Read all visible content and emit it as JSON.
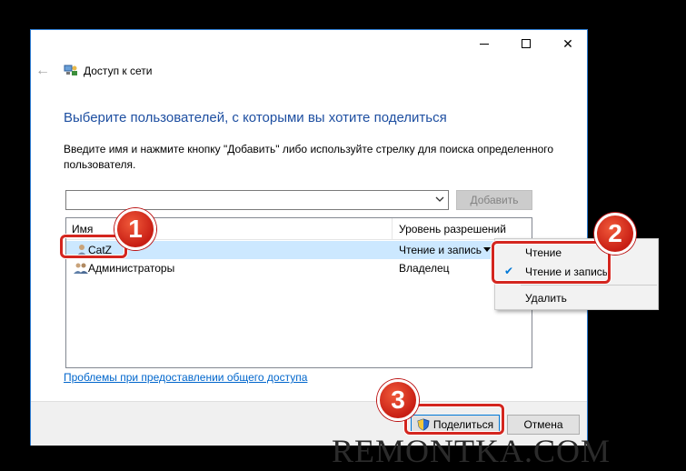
{
  "window": {
    "title": "Доступ к сети",
    "heading": "Выберите пользователей, с которыми вы хотите поделиться",
    "description": "Введите имя и нажмите кнопку \"Добавить\" либо используйте стрелку для поиска определенного пользователя.",
    "user_input_value": "",
    "add_button": "Добавить"
  },
  "table": {
    "col_name": "Имя",
    "col_permission": "Уровень разрешений",
    "rows": [
      {
        "name": "CatZ",
        "permission": "Чтение и запись"
      },
      {
        "name": "Администраторы",
        "permission": "Владелец"
      }
    ]
  },
  "context_menu": {
    "items": [
      "Чтение",
      "Чтение и запись",
      "Удалить"
    ],
    "checked": "Чтение и запись"
  },
  "help_link": "Проблемы при предоставлении общего доступа",
  "footer": {
    "share_button": "Поделиться",
    "cancel_button": "Отмена"
  },
  "badges": [
    "1",
    "2",
    "3"
  ],
  "watermark": "REMONTKA.COM",
  "colors": {
    "heading": "#1e4fa1",
    "link": "#0066cc",
    "selection": "#cce8ff",
    "highlight": "#d4261f"
  }
}
